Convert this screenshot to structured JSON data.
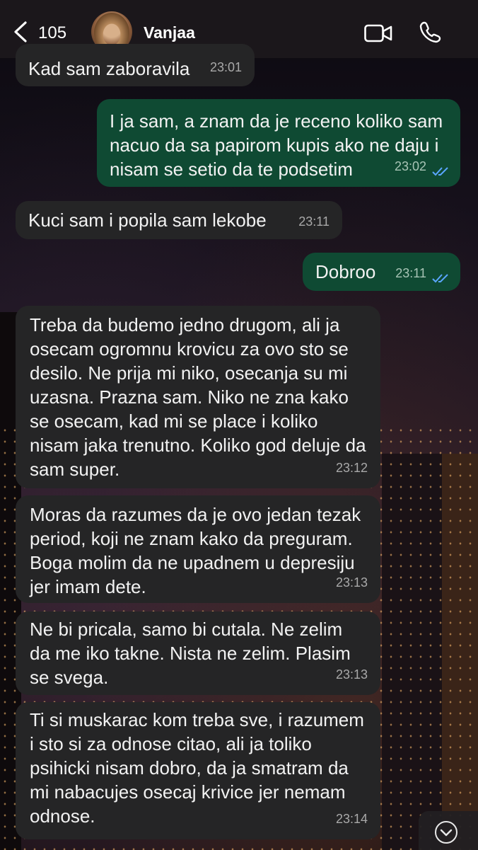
{
  "header": {
    "back_count": "105",
    "contact_name": "Vanjaa"
  },
  "messages": [
    {
      "direction": "incoming",
      "text": "Kad sam zaboravila",
      "time": "23:01"
    },
    {
      "direction": "outgoing",
      "text": "I ja sam, a znam da je receno koliko sam nacuo da sa papirom kupis ako ne daju i nisam se setio da te podsetim",
      "time": "23:02",
      "status": "read"
    },
    {
      "direction": "incoming",
      "text": "Kuci sam i popila sam lekobe",
      "time": "23:11"
    },
    {
      "direction": "outgoing",
      "text": "Dobroo",
      "time": "23:11",
      "status": "read"
    },
    {
      "direction": "incoming",
      "text": "Treba da budemo jedno drugom, ali ja osecam ogromnu krovicu za ovo sto se desilo. Ne prija mi niko, osecanja su mi uzasna. Prazna sam. Niko ne zna kako se osecam, kad mi se place i koliko nisam jaka trenutno. Koliko god deluje da sam super.",
      "time": "23:12"
    },
    {
      "direction": "incoming",
      "text": "Moras da razumes da je ovo jedan tezak period, koji ne znam kako da preguram. Boga molim da ne upadnem u depresiju jer imam dete.",
      "time": "23:13"
    },
    {
      "direction": "incoming",
      "text": "Ne bi pricala, samo bi cutala. Ne zelim da me iko takne. Nista ne zelim. Plasim se svega.",
      "time": "23:13"
    },
    {
      "direction": "incoming",
      "text": "Ti si muskarac kom treba sve, i razumem i sto si za odnose citao, ali ja toliko psihicki nisam dobro, da ja smatram da mi nabacujes osecaj krivice jer nemam odnose.",
      "time": "23:14"
    }
  ],
  "icons": {
    "back": "chevron-left-icon",
    "video": "video-camera-icon",
    "call": "phone-icon",
    "read_status": "double-check-icon",
    "scroll_down": "chevron-down-icon"
  },
  "colors": {
    "incoming_bubble": "#252526",
    "outgoing_bubble": "#0f4a33",
    "read_ticks": "#5aa6ff"
  }
}
